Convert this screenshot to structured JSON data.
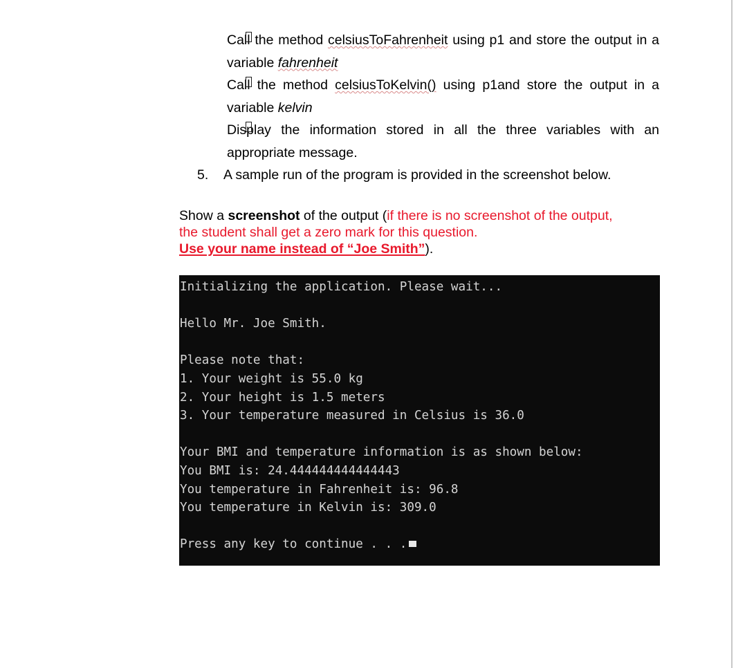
{
  "document": {
    "bullets": [
      {
        "marker": "tofu-box",
        "pre": "Call the method ",
        "method": "celsiusToFahrenheit",
        "mid": " using p1 and store the output in a variable ",
        "variable": "fahrenheit",
        "post": ""
      },
      {
        "marker": "tofu-box",
        "pre": "Call the method ",
        "method": "celsiusToKelvin()",
        "mid": " using p1and store the output in a variable ",
        "variable": "kelvin",
        "post": ""
      },
      {
        "marker": "tofu-box",
        "pre": "Display the information stored in all the three variables with an appropriate message.",
        "method": "",
        "mid": "",
        "variable": "",
        "post": ""
      }
    ],
    "numbered_item": {
      "number": "5.",
      "text": "A sample run of the program is provided in the screenshot below."
    },
    "instruction": {
      "line1_part1": "Show a ",
      "line1_bold": "screenshot",
      "line1_part2": " of the output (",
      "line1_red": "if there is no screenshot of the output,",
      "line2_red": "the student shall get a zero mark for this question.",
      "line3_red_bold_underline": "Use your name instead of “Joe Smith”",
      "line3_tail": ")."
    },
    "colors": {
      "red_accent": "#e8192c",
      "spellcheck_squiggle": "#d98b8b",
      "terminal_background": "#0c0c0c",
      "terminal_text": "#d4d4d4",
      "scrollbar_thumb": "#9b9b9b"
    }
  },
  "terminal": {
    "lines": [
      "Initializing the application. Please wait...",
      "",
      "Hello Mr. Joe Smith.",
      "",
      "Please note that:",
      "1. Your weight is 55.0 kg",
      "2. Your height is 1.5 meters",
      "3. Your temperature measured in Celsius is 36.0",
      "",
      "Your BMI and temperature information is as shown below:",
      "You BMI is: 24.444444444444443",
      "You temperature in Fahrenheit is: 96.8",
      "You temperature in Kelvin is: 309.0",
      "",
      "Press any key to continue . . ."
    ],
    "cursor": "block-cursor"
  },
  "scrollbar": {
    "orientation": "vertical",
    "thumb_label": "scrollbar-thumb-grip"
  }
}
